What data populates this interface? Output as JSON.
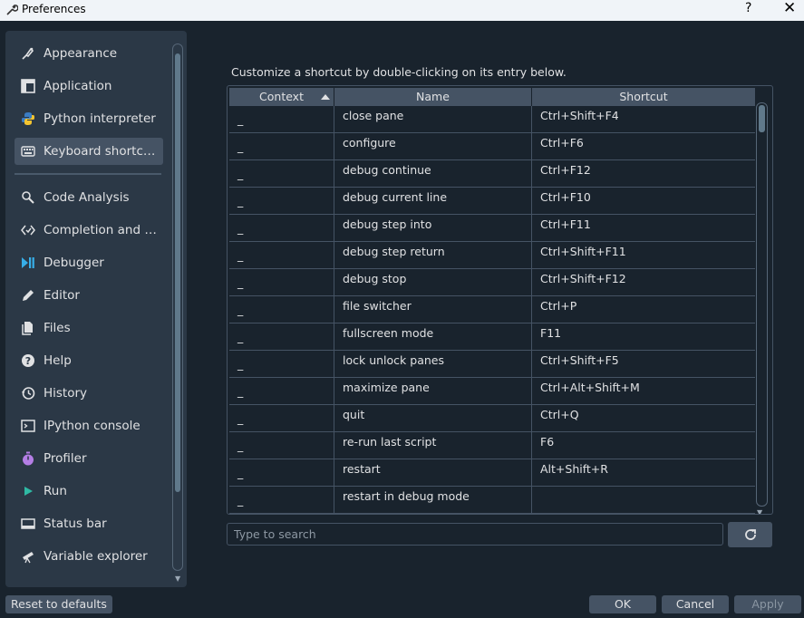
{
  "window": {
    "title": "Preferences",
    "help_glyph": "?",
    "close_glyph": "✕"
  },
  "sidebar": {
    "items": [
      {
        "label": "Appearance",
        "icon": "paint-brush-icon",
        "selected": false
      },
      {
        "label": "Application",
        "icon": "layout-icon",
        "selected": false
      },
      {
        "label": "Python interpreter",
        "icon": "python-icon",
        "selected": false
      },
      {
        "label": "Keyboard shortcuts",
        "icon": "keyboard-icon",
        "selected": true
      },
      {
        "label": "Code Analysis",
        "icon": "code-analysis-icon",
        "selected": false
      },
      {
        "label": "Completion and linting",
        "icon": "completion-icon",
        "selected": false
      },
      {
        "label": "Debugger",
        "icon": "debugger-icon",
        "selected": false
      },
      {
        "label": "Editor",
        "icon": "pencil-icon",
        "selected": false
      },
      {
        "label": "Files",
        "icon": "files-icon",
        "selected": false
      },
      {
        "label": "Help",
        "icon": "help-icon",
        "selected": false
      },
      {
        "label": "History",
        "icon": "history-icon",
        "selected": false
      },
      {
        "label": "IPython console",
        "icon": "terminal-icon",
        "selected": false
      },
      {
        "label": "Profiler",
        "icon": "stopwatch-icon",
        "selected": false
      },
      {
        "label": "Run",
        "icon": "play-icon",
        "selected": false
      },
      {
        "label": "Status bar",
        "icon": "status-bar-icon",
        "selected": false
      },
      {
        "label": "Variable explorer",
        "icon": "telescope-icon",
        "selected": false
      }
    ]
  },
  "main": {
    "description": "Customize a shortcut by double-clicking on its entry below.",
    "table": {
      "columns": [
        "Context",
        "Name",
        "Shortcut"
      ],
      "rows": [
        {
          "context": "_",
          "name": "close pane",
          "shortcut": "Ctrl+Shift+F4"
        },
        {
          "context": "_",
          "name": "configure",
          "shortcut": "Ctrl+F6"
        },
        {
          "context": "_",
          "name": "debug continue",
          "shortcut": "Ctrl+F12"
        },
        {
          "context": "_",
          "name": "debug current line",
          "shortcut": "Ctrl+F10"
        },
        {
          "context": "_",
          "name": "debug step into",
          "shortcut": "Ctrl+F11"
        },
        {
          "context": "_",
          "name": "debug step return",
          "shortcut": "Ctrl+Shift+F11"
        },
        {
          "context": "_",
          "name": "debug stop",
          "shortcut": "Ctrl+Shift+F12"
        },
        {
          "context": "_",
          "name": "file switcher",
          "shortcut": "Ctrl+P"
        },
        {
          "context": "_",
          "name": "fullscreen mode",
          "shortcut": "F11"
        },
        {
          "context": "_",
          "name": "lock unlock panes",
          "shortcut": "Ctrl+Shift+F5"
        },
        {
          "context": "_",
          "name": "maximize pane",
          "shortcut": "Ctrl+Alt+Shift+M"
        },
        {
          "context": "_",
          "name": "quit",
          "shortcut": "Ctrl+Q"
        },
        {
          "context": "_",
          "name": "re-run last script",
          "shortcut": "F6"
        },
        {
          "context": "_",
          "name": "restart",
          "shortcut": "Alt+Shift+R"
        },
        {
          "context": "_",
          "name": "restart in debug mode",
          "shortcut": ""
        }
      ]
    },
    "search": {
      "placeholder": "Type to search",
      "value": ""
    }
  },
  "footer": {
    "reset": "Reset to defaults",
    "ok": "OK",
    "cancel": "Cancel",
    "apply": "Apply"
  },
  "colors": {
    "background": "#19232d",
    "panel": "#2b3846",
    "selected": "#455364",
    "text": "#e0e1e3",
    "accent_blue": "#37aee8",
    "accent_purple": "#b47ee5",
    "accent_green": "#2fb9a4"
  }
}
